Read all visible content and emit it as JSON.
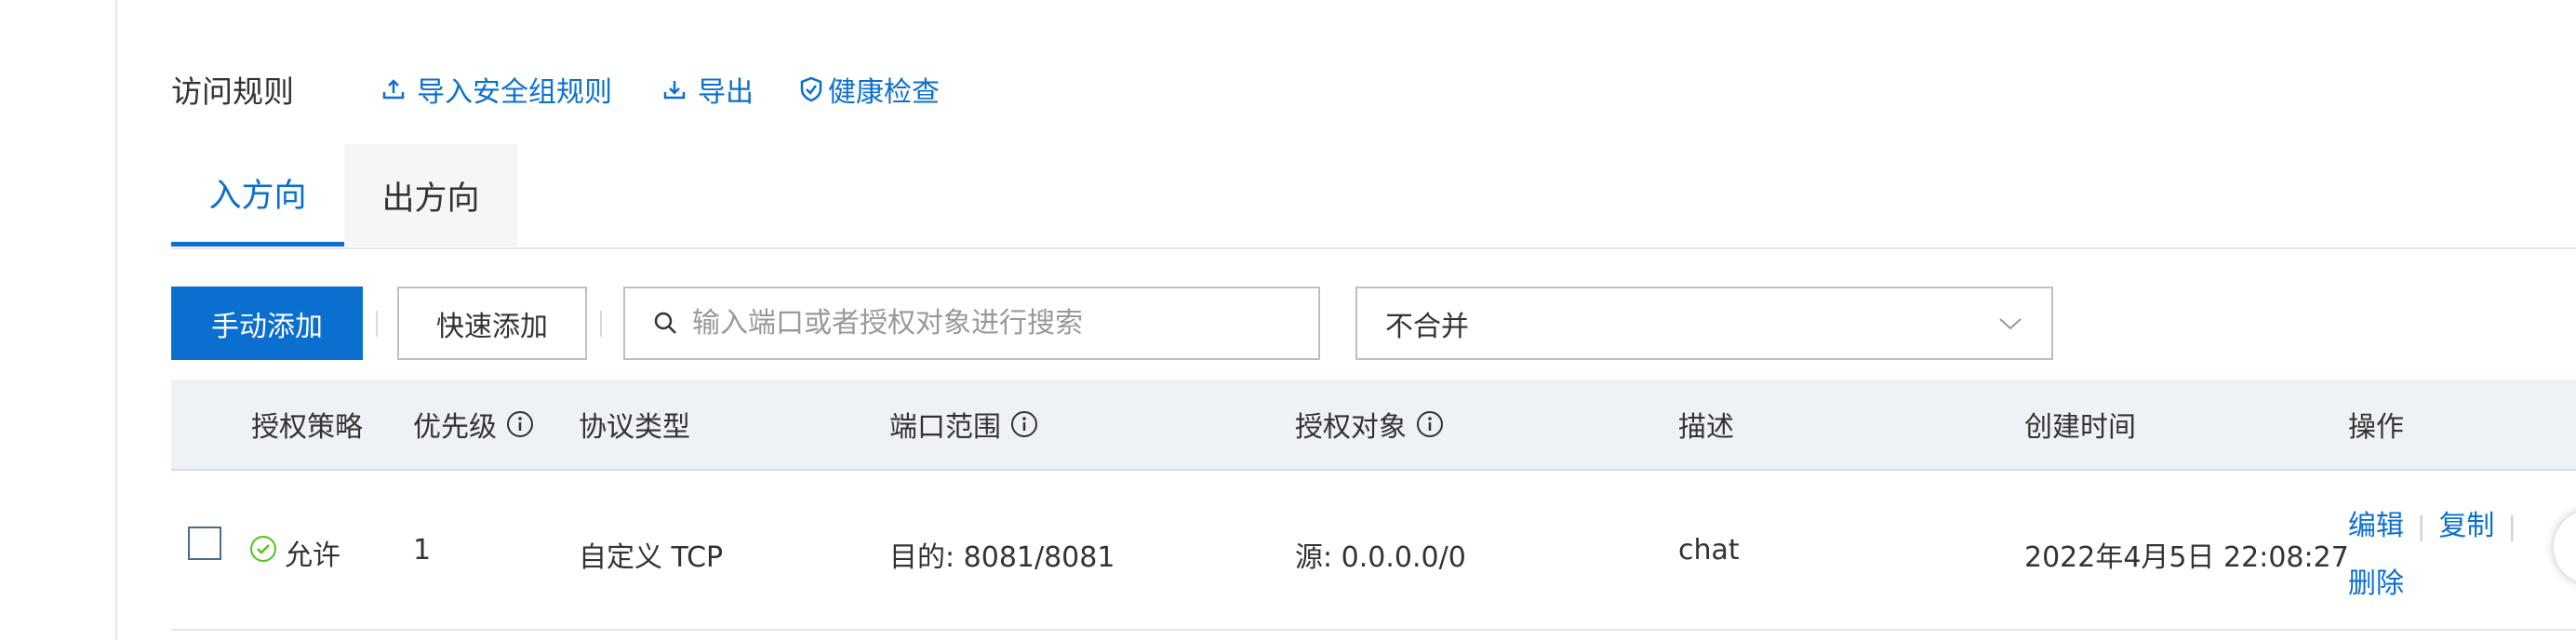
{
  "title": "访问规则",
  "actions": {
    "import": "导入安全组规则",
    "export": "导出",
    "health": "健康检查"
  },
  "tabs": [
    {
      "label": "入方向",
      "active": true
    },
    {
      "label": "出方向",
      "active": false
    }
  ],
  "toolbar": {
    "manual_add": "手动添加",
    "quick_add": "快速添加",
    "search_placeholder": "输入端口或者授权对象进行搜索",
    "merge_select": "不合并"
  },
  "table": {
    "columns": [
      "授权策略",
      "优先级",
      "协议类型",
      "端口范围",
      "授权对象",
      "描述",
      "创建时间",
      "操作"
    ],
    "rows": [
      {
        "policy": "允许",
        "priority": "1",
        "protocol": "自定义 TCP",
        "port": "目的: 8081/8081",
        "auth": "源: 0.0.0.0/0",
        "desc": "chat",
        "created": "2022年4月5日 22:08:27",
        "ops": [
          "编辑",
          "复制",
          "删除"
        ]
      }
    ]
  },
  "colors": {
    "accent": "#0b6fd0",
    "header_bg": "#eef1f6",
    "success": "#52c41a"
  }
}
